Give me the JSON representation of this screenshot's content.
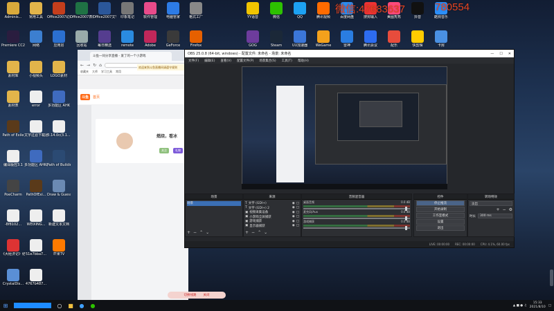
{
  "overlay_text": {
    "left": "微信:47683637",
    "right": "780554"
  },
  "desktop_icons_left": [
    {
      "label": "Adminis...",
      "icon": "user-folder-icon",
      "color": "#d9a93b"
    },
    {
      "label": "常用工具",
      "icon": "folder-icon",
      "color": "#e2b44a"
    },
    {
      "label": "Office2007幻灯片PPT",
      "icon": "powerpoint-icon",
      "color": "#c43e1c"
    },
    {
      "label": "Office2007表格",
      "icon": "excel-icon",
      "color": "#1f7244"
    },
    {
      "label": "Office2007文字",
      "icon": "word-icon",
      "color": "#2b579a"
    },
    {
      "label": "印象笔记",
      "icon": "note-icon",
      "color": "#777"
    },
    {
      "label": "软件管理",
      "icon": "software-icon",
      "color": "#e84b8a"
    },
    {
      "label": "电脑管家",
      "icon": "shield-icon",
      "color": "#2d7be5"
    },
    {
      "label": "格式工厂",
      "icon": "factory-icon",
      "color": "#888"
    },
    {
      "label": "Premiere CC2019",
      "icon": "premiere-icon",
      "color": "#2a1d3f"
    },
    {
      "label": "网络",
      "icon": "network-icon",
      "color": "#3c7fd0"
    },
    {
      "label": "应用层",
      "icon": "app-icon",
      "color": "#2b6fd0"
    },
    {
      "label": "回收站",
      "icon": "recycle-bin-icon",
      "color": "#9aa"
    },
    {
      "label": "每日精选",
      "icon": "daily-icon",
      "color": "#553d8f"
    },
    {
      "label": "remote",
      "icon": "remote-icon",
      "color": "#2a8be0"
    },
    {
      "label": "Adobe",
      "icon": "adobe-icon",
      "color": "#c0275a"
    },
    {
      "label": "GeForce",
      "icon": "geforce-icon",
      "color": "#3a3a3a"
    },
    {
      "label": "Firefox",
      "icon": "firefox-icon",
      "color": "#e66000"
    },
    {
      "label": "素材库",
      "icon": "folder-icon",
      "color": "#e2b44a"
    },
    {
      "label": "小视频头",
      "icon": "folder-icon",
      "color": "#e2b44a"
    },
    {
      "label": "LOGO素材",
      "icon": "folder-icon",
      "color": "#e2b44a"
    },
    {
      "label": "素材表",
      "icon": "folder-icon",
      "color": "#e2b44a"
    },
    {
      "label": "error",
      "icon": "file-icon",
      "color": "#eee"
    },
    {
      "label": "多功能区 AHK",
      "icon": "ahk-icon",
      "color": "#3f6bbf"
    },
    {
      "label": "Path of Exile",
      "icon": "poe-icon",
      "color": "#5a3a1a"
    },
    {
      "label": "文字过滤下载通知",
      "icon": "file-icon",
      "color": "#eee"
    },
    {
      "label": "3.14.0c(3.1...",
      "icon": "file-icon",
      "color": "#eee"
    },
    {
      "label": "编译版控3.1",
      "icon": "file-icon",
      "color": "#eee"
    },
    {
      "label": "多功能区 AHK(20.10...",
      "icon": "ahk-icon",
      "color": "#3f6bbf"
    },
    {
      "label": "Path of Building",
      "icon": "pob-icon",
      "color": "#2b4a73"
    },
    {
      "label": "PoeCharm",
      "icon": "poecharm-icon",
      "color": "#444"
    },
    {
      "label": "PathOfExi...",
      "icon": "poe-icon",
      "color": "#5a3a1a"
    },
    {
      "label": "Draw & Guess",
      "icon": "draw-icon",
      "color": "#6b8ab3"
    },
    {
      "label": "-8f8102...",
      "icon": "file-icon",
      "color": "#eee"
    },
    {
      "label": "WEIXING...",
      "icon": "file-icon",
      "color": "#eee"
    },
    {
      "label": "新建文本文档",
      "icon": "text-file-icon",
      "color": "#eee"
    },
    {
      "label": "《大经济记》结构数尔子...",
      "icon": "pdf-icon",
      "color": "#d33"
    },
    {
      "label": "51e7bba7...",
      "icon": "file-icon",
      "color": "#eee"
    },
    {
      "label": "芒果TV",
      "icon": "mango-tv-icon",
      "color": "#ff7a00"
    },
    {
      "label": "CrystalDis...",
      "icon": "crystal-disk-icon",
      "color": "#5a8fd6"
    },
    {
      "label": "4767b487...",
      "icon": "file-icon",
      "color": "#eee"
    }
  ],
  "desktop_icons_right": [
    {
      "label": "YY语音",
      "icon": "yy-icon",
      "color": "#f0c400"
    },
    {
      "label": "微信",
      "icon": "wechat-icon",
      "color": "#2dc100"
    },
    {
      "label": "QQ",
      "icon": "qq-icon",
      "color": "#1da1f2"
    },
    {
      "label": "腾讯视频",
      "icon": "tencent-video-icon",
      "color": "#ff6b00"
    },
    {
      "label": "百度网盘",
      "icon": "baidu-pan-icon",
      "color": "#2d8cf0"
    },
    {
      "label": "搜狗输入",
      "icon": "sogou-icon",
      "color": "#e33"
    },
    {
      "label": "美图秀秀",
      "icon": "meitu-icon",
      "color": "#ff4a7a"
    },
    {
      "label": "抖音",
      "icon": "douyin-icon",
      "color": "#111"
    },
    {
      "label": "酷狗音乐",
      "icon": "kugou-icon",
      "color": "#2c8ef8"
    },
    {
      "label": "GOG",
      "icon": "gog-icon",
      "color": "#6d3c9c"
    },
    {
      "label": "Steam",
      "icon": "steam-icon",
      "color": "#1b2838"
    },
    {
      "label": "UU加速器",
      "icon": "uu-icon",
      "color": "#3b76d8"
    },
    {
      "label": "WeGame",
      "icon": "wegame-icon",
      "color": "#f3a11c"
    },
    {
      "label": "雷神",
      "icon": "thunder-icon",
      "color": "#2a7de1"
    },
    {
      "label": "腾讯会议",
      "icon": "meeting-icon",
      "color": "#2d6cf0"
    },
    {
      "label": "配乐",
      "icon": "music-icon",
      "color": "#e74c3c"
    },
    {
      "label": "快剪辑",
      "icon": "edit-icon",
      "color": "#ffcc00"
    },
    {
      "label": "卡房",
      "icon": "card-icon",
      "color": "#4a90e2"
    }
  ],
  "browser": {
    "tab_title": "斗鱼一同分享直播 - 爱了的一个小游戏",
    "bookmarks": [
      "收藏夹",
      "大师",
      "学习工具",
      "常用"
    ],
    "notice": "欢迎来到斗鱼直播间请遵守规则",
    "nav_home": "首页",
    "brand": "斗鱼",
    "promo": "燃烧，看冰",
    "promo_buttons": [
      "关注",
      "礼物"
    ],
    "bottom_buttons": [
      "切换线路",
      "关闭"
    ]
  },
  "obs": {
    "window_title": "OBS 25.0.8 (64-bit, windows) - 配置文件: 未命名 - 场景: 未命名",
    "menu": [
      "文件(F)",
      "编辑(E)",
      "查看(V)",
      "配置文件(P)",
      "场景集合(S)",
      "工具(T)",
      "帮助(H)"
    ],
    "docks": {
      "scenes_title": "场景",
      "scenes": [
        "场景"
      ],
      "sources_title": "来源",
      "sources": [
        "文字 (GDI+)",
        "文字 (GDI+) 2",
        "视频采集设备",
        "小游戏全屏捕获",
        "游戏捕获",
        "显示器捕获"
      ],
      "mixer_title": "音频混音器",
      "mixer": [
        {
          "name": "桌面音频",
          "db": "0.0 dB"
        },
        {
          "name": "麦克风/Aux",
          "db": "0.0 dB"
        },
        {
          "name": "游戏捕获",
          "db": "0.0 dB"
        }
      ],
      "transitions_title": "转场特效",
      "transition_value": "淡出",
      "duration_label": "时长",
      "duration_value": "300 ms",
      "controls_title": "控件",
      "controls": [
        "停止推流",
        "开始录制",
        "工作室模式",
        "设置",
        "退出"
      ]
    },
    "status": {
      "live": "LIVE: 00:00:00",
      "rec": "REC: 00:00:00",
      "cpu": "CPU: 4.1%, 60.00 fps"
    }
  },
  "taskbar": {
    "time": "15:33",
    "date": "2021/8/10"
  }
}
